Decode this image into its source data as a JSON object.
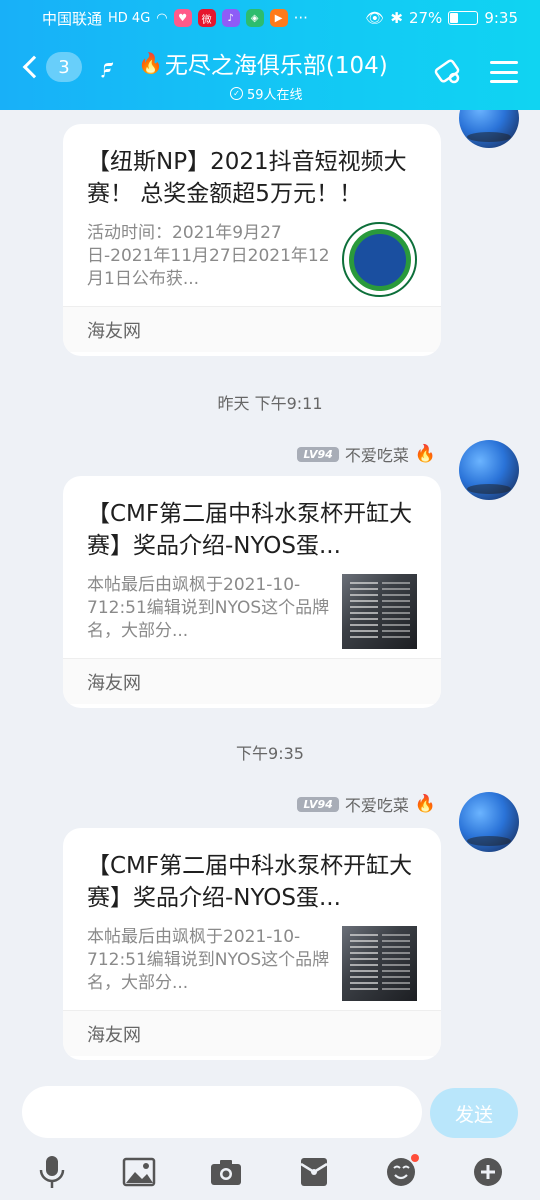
{
  "status_bar": {
    "carrier": "中国联通",
    "signal": "HD 4G",
    "battery_pct": "27%",
    "time": "9:35"
  },
  "header": {
    "back_count": "3",
    "title": "无尽之海俱乐部(104)",
    "online": "59人在线"
  },
  "messages": [
    {
      "title": "【纽斯NP】2021抖音短视频大赛！ 总奖金额超5万元！！",
      "desc": "活动时间：2021年9月27日-2021年11月27日2021年12月1日公布获...",
      "source": "海友网",
      "thumb": "logo"
    },
    {
      "time": "昨天 下午9:11",
      "level": "LV94",
      "sender": "不爱吃菜",
      "title": "【CMF第二届中科水泵杯开缸大赛】奖品介绍-NYOS蛋...",
      "desc": "本帖最后由飒枫于2021-10-712:51编辑说到NYOS这个品牌名，大部分...",
      "source": "海友网",
      "thumb": "photo"
    },
    {
      "time": "下午9:35",
      "level": "LV94",
      "sender": "不爱吃菜",
      "title": "【CMF第二届中科水泵杯开缸大赛】奖品介绍-NYOS蛋...",
      "desc": "本帖最后由飒枫于2021-10-712:51编辑说到NYOS这个品牌名，大部分...",
      "source": "海友网",
      "thumb": "photo"
    }
  ],
  "input": {
    "placeholder": "",
    "send_label": "发送"
  },
  "toolbar": [
    "mic-icon",
    "image-icon",
    "camera-icon",
    "red-packet-icon",
    "emoji-icon",
    "plus-icon"
  ],
  "colors": {
    "header_start": "#18b0f8",
    "header_end": "#10d4f2",
    "send_disabled": "#b9e6fb",
    "notify_dot": "#ff4d3a"
  }
}
